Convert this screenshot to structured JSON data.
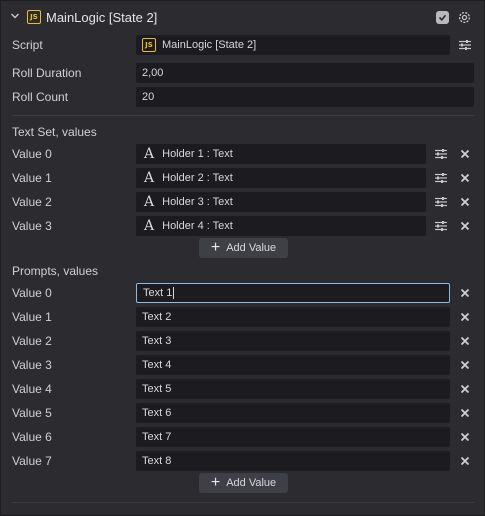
{
  "header": {
    "title": "MainLogic [State 2]",
    "js_badge": "JS",
    "accent": "#e6c027"
  },
  "script": {
    "label": "Script",
    "value": "MainLogic [State 2]",
    "js_badge": "JS"
  },
  "roll_duration": {
    "label": "Roll Duration",
    "value": "2,00"
  },
  "roll_count": {
    "label": "Roll Count",
    "value": "20"
  },
  "text_set": {
    "title": "Text Set, values",
    "items": [
      {
        "label": "Value 0",
        "value": "Holder 1 : Text"
      },
      {
        "label": "Value 1",
        "value": "Holder 2 : Text"
      },
      {
        "label": "Value 2",
        "value": "Holder 3 : Text"
      },
      {
        "label": "Value 3",
        "value": "Holder 4 : Text"
      }
    ],
    "add_label": "Add Value"
  },
  "prompts": {
    "title": "Prompts, values",
    "items": [
      {
        "label": "Value 0",
        "value": "Text 1"
      },
      {
        "label": "Value 1",
        "value": "Text 2"
      },
      {
        "label": "Value 2",
        "value": "Text 3"
      },
      {
        "label": "Value 3",
        "value": "Text 4"
      },
      {
        "label": "Value 4",
        "value": "Text 5"
      },
      {
        "label": "Value 5",
        "value": "Text 6"
      },
      {
        "label": "Value 6",
        "value": "Text 7"
      },
      {
        "label": "Value 7",
        "value": "Text 8"
      }
    ],
    "add_label": "Add Value"
  },
  "holder_glyph": "A"
}
